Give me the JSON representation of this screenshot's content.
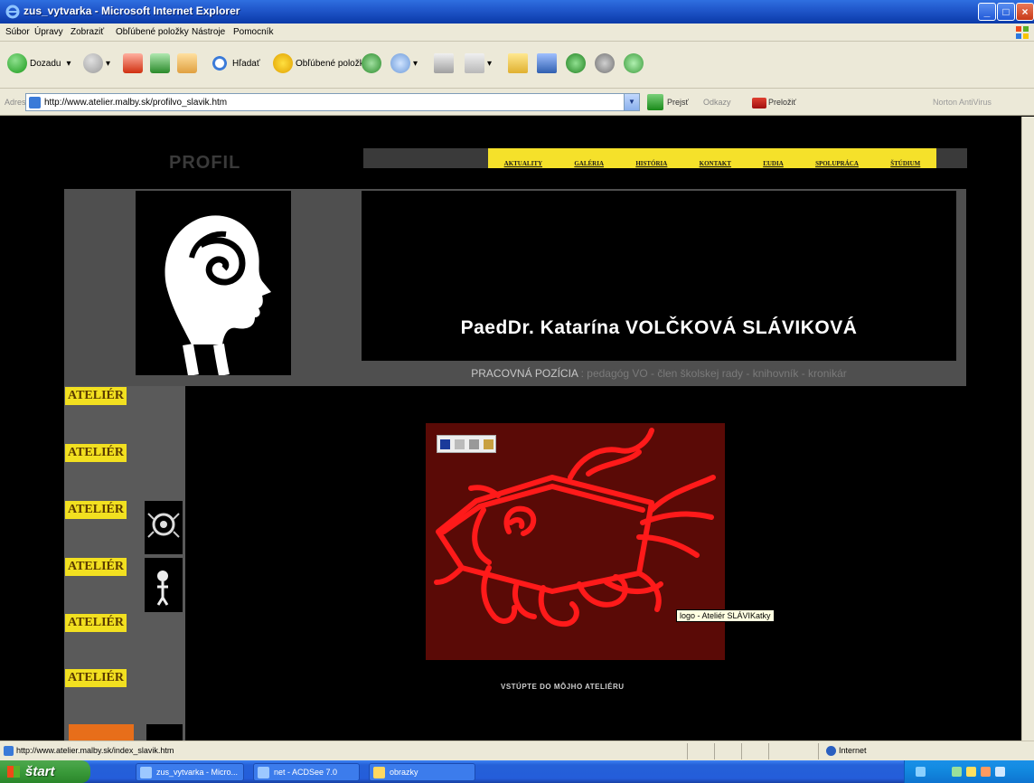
{
  "window": {
    "title": "zus_vytvarka - Microsoft Internet Explorer"
  },
  "menu": [
    "Súbor",
    "Úpravy",
    "Zobraziť",
    "Obľúbené položky",
    "Nástroje",
    "Pomocník"
  ],
  "toolbar": {
    "back": "Dozadu",
    "search": "Hľadať",
    "favorites": "Obľúbené položky"
  },
  "address": {
    "label": "Adresa",
    "url": "http://www.atelier.malby.sk/profilvo_slavik.htm",
    "go": "Prejsť",
    "links": "Odkazy",
    "translate": "Preložiť",
    "norton": "Norton AntiVirus"
  },
  "page": {
    "profil": "PROFIL",
    "nav": [
      "AKTUALITY",
      "GALÉRIA",
      "HISTÓRIA",
      "KONTAKT",
      "ĽUDIA",
      "SPOLUPRÁCA",
      "ŠTÚDIUM"
    ],
    "name": "PaedDr. Katarína VOLČKOVÁ SLÁVIKOVÁ",
    "position_label": "PRACOVNÁ POZÍCIA",
    "position_value": ": pedagóg VO - člen školskej rady - knihovník - kronikár",
    "sidebar": [
      "ATELIÉR",
      "ATELIÉR",
      "ATELIÉR",
      "ATELIÉR",
      "ATELIÉR",
      "ATELIÉR"
    ],
    "tooltip": "logo - Ateliér SLÁVIKatky",
    "enter": "VSTÚPTE DO MÔJHO ATELIÉRU"
  },
  "status": {
    "url": "http://www.atelier.malby.sk/index_slavik.htm",
    "zone": "Internet"
  },
  "taskbar": {
    "start": "štart",
    "tasks": [
      "zus_vytvarka - Micro...",
      "net - ACDSee 7.0",
      "obrazky"
    ]
  },
  "colors": {
    "nav_yellow": "#f5e12a",
    "art_red": "#ff1a1a",
    "art_bg": "#5a0a06"
  }
}
